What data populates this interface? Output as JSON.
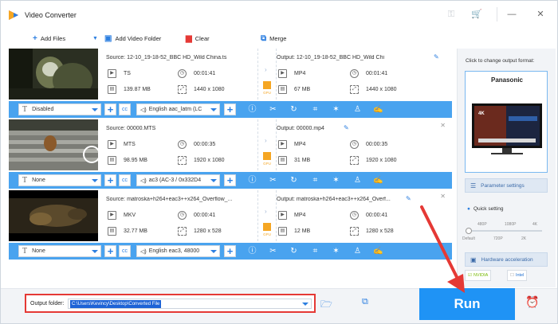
{
  "app": {
    "title": "Video Converter",
    "colors": {
      "accent": "#49a3ef",
      "run": "#1f93f5",
      "highlight": "#e53935"
    }
  },
  "titlebar": {
    "icons": [
      "key-icon",
      "cart-icon",
      "minimize-icon",
      "close-icon"
    ]
  },
  "toolbar": {
    "add_files": "Add Files",
    "add_video_folder": "Add Video Folder",
    "clear": "Clear",
    "merge": "Merge"
  },
  "items": [
    {
      "source": "Source: 12-10_19-18-52_BBC HD_Wild China.ts",
      "src_format": "TS",
      "src_duration": "00:01:41",
      "src_size": "139.87 MB",
      "src_resolution": "1440 x 1080",
      "output": "Output: 12-10_19-18-52_BBC HD_Wild Chi",
      "out_format": "MP4",
      "out_duration": "00:01:41",
      "out_size": "67 MB",
      "out_resolution": "1440 x 1080",
      "subtitle": "Disabled",
      "audio": "English aac_latm (LC"
    },
    {
      "source": "Source: 00000.MTS",
      "src_format": "MTS",
      "src_duration": "00:00:35",
      "src_size": "98.95 MB",
      "src_resolution": "1920 x 1080",
      "output": "Output: 00000.mp4",
      "out_format": "MP4",
      "out_duration": "00:00:35",
      "out_size": "31 MB",
      "out_resolution": "1920 x 1080",
      "subtitle": "None",
      "audio": "ac3 (AC-3 / 0x332D4"
    },
    {
      "source": "Source: matroska+h264+eac3++x264_Overflow_...",
      "src_format": "MKV",
      "src_duration": "00:00:41",
      "src_size": "32.77 MB",
      "src_resolution": "1280 x 528",
      "output": "Output: matroska+h264+eac3++x264_Overf...",
      "out_format": "MP4",
      "out_duration": "00:00:41",
      "out_size": "12 MB",
      "out_resolution": "1280 x 528",
      "subtitle": "None",
      "audio": "English eac3, 48000"
    }
  ],
  "panel": {
    "change_format": "Click to change output format:",
    "format_name": "Panasonic",
    "parameter_settings": "Parameter settings",
    "quick_setting": "Quick setting",
    "ticks_top": [
      "480P",
      "1080P",
      "4K"
    ],
    "ticks_bottom": [
      "Default",
      "720P",
      "2K"
    ],
    "quality_level": 0.0,
    "hardware_acceleration": "Hardware acceleration",
    "nvidia": "NVIDIA",
    "intel": "Intel"
  },
  "bottom": {
    "output_folder_label": "Output folder:",
    "output_folder_value": "C:\\Users\\Kevincy\\Desktop\\Converted File",
    "run_label": "Run"
  }
}
